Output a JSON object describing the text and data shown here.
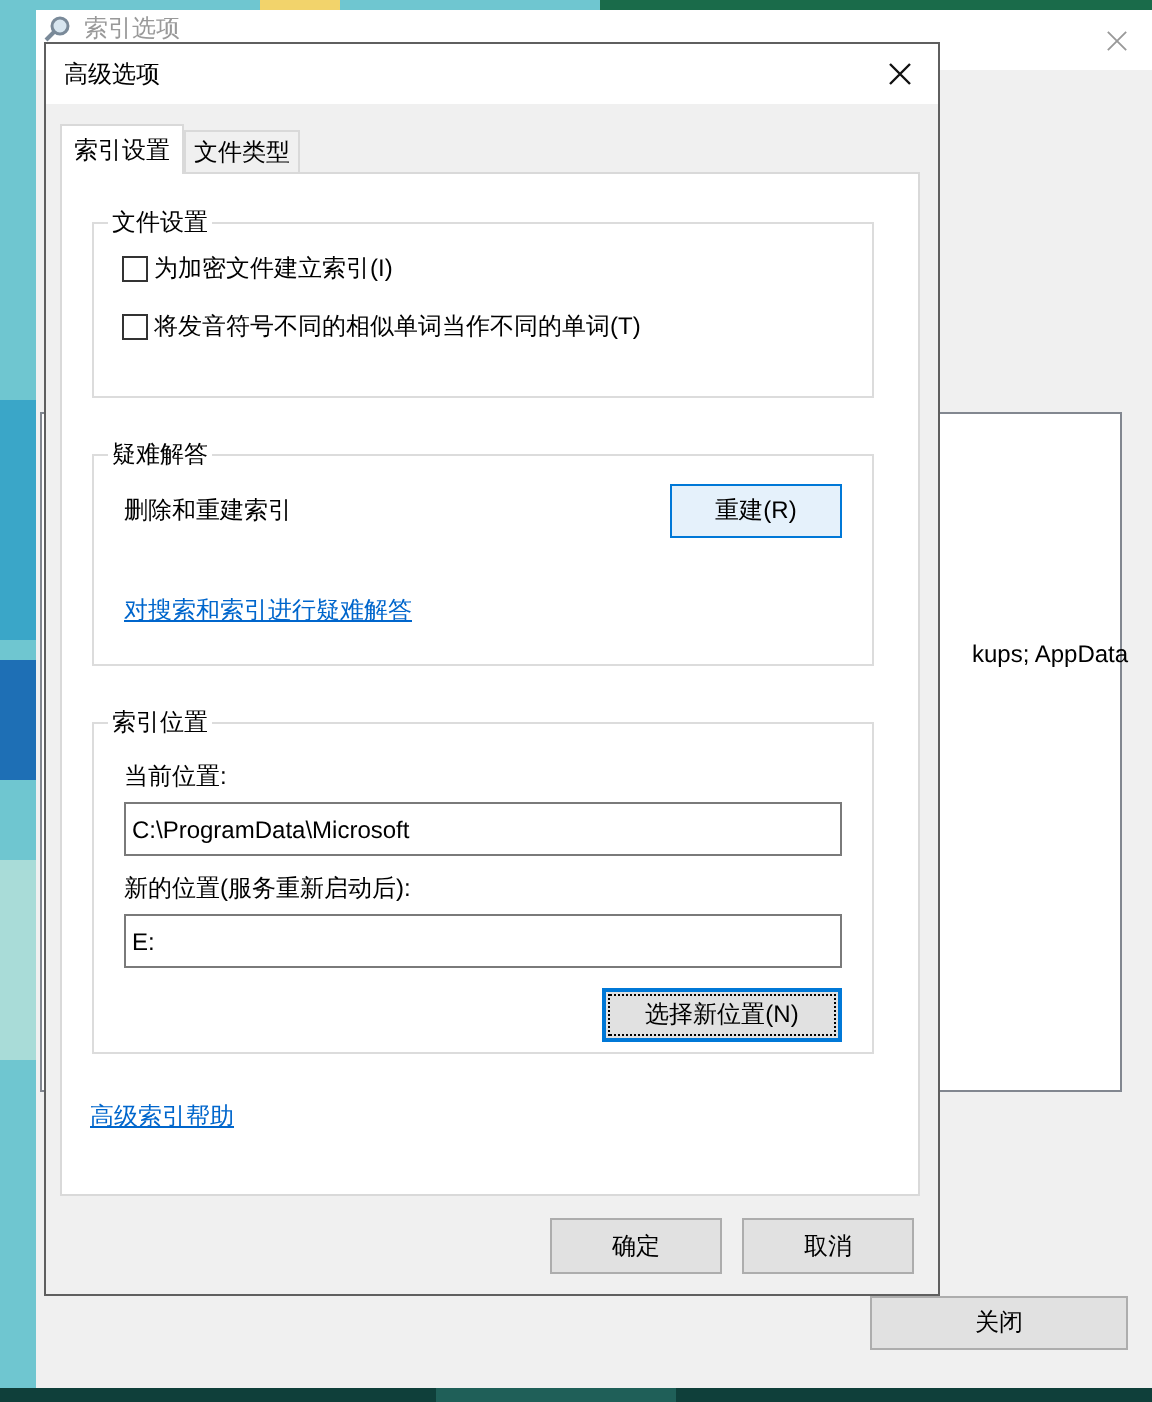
{
  "background_window": {
    "title": "索引选项",
    "list_text": "kups; AppData",
    "close_button": "关闭"
  },
  "dialog": {
    "title": "高级选项",
    "tabs": [
      {
        "label": "索引设置",
        "selected": true
      },
      {
        "label": "文件类型",
        "selected": false
      }
    ],
    "file_settings": {
      "title": "文件设置",
      "options": [
        {
          "label": "为加密文件建立索引(I)",
          "checked": false
        },
        {
          "label": "将发音符号不同的相似单词当作不同的单词(T)",
          "checked": false
        }
      ]
    },
    "troubleshooting": {
      "title": "疑难解答",
      "text": "删除和重建索引",
      "rebuild_button": "重建(R)",
      "link": "对搜索和索引进行疑难解答"
    },
    "index_location": {
      "title": "索引位置",
      "current_label": "当前位置:",
      "current_value": "C:\\ProgramData\\Microsoft",
      "new_label": "新的位置(服务重新启动后):",
      "new_value": "E:",
      "select_button": "选择新位置(N)"
    },
    "help_link": "高级索引帮助",
    "buttons": [
      "确定",
      "取消"
    ]
  }
}
